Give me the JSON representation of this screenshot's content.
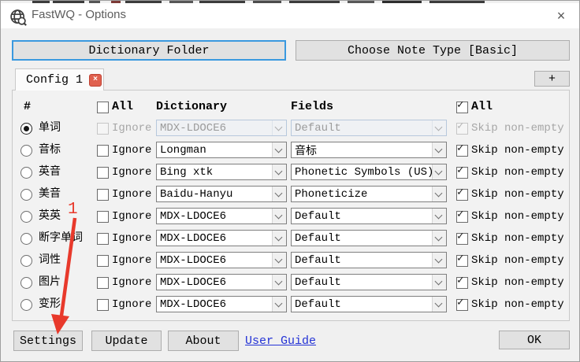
{
  "window": {
    "title": "FastWQ - Options"
  },
  "icons": {
    "app_icon": "globe-search",
    "close_icon": "×",
    "tab_close_icon": "×",
    "combo_chevron_icon": "v",
    "annotation_arrow_icon": "red-arrow-down"
  },
  "top_buttons": {
    "dictionary_folder": "Dictionary Folder",
    "choose_note_type": "Choose Note Type [Basic]"
  },
  "tabs": {
    "active_tab": "Config 1",
    "add_tab": "+"
  },
  "table": {
    "headers": {
      "hash": "#",
      "all_left": "All",
      "dictionary": "Dictionary",
      "fields": "Fields",
      "all_right": "All"
    },
    "all_left_checked": false,
    "all_right_checked": true,
    "ignore_label": "Ignore",
    "skip_label": "Skip non-empty",
    "rows": [
      {
        "label": "单词",
        "dictionary": "MDX-LDOCE6",
        "field": "Default",
        "selected": true,
        "disabled": true,
        "ignore_checked": false,
        "skip_checked": true
      },
      {
        "label": "音标",
        "dictionary": "Longman",
        "field": "音标",
        "selected": false,
        "disabled": false,
        "ignore_checked": false,
        "skip_checked": true
      },
      {
        "label": "英音",
        "dictionary": "Bing xtk",
        "field": "Phonetic Symbols (US)",
        "selected": false,
        "disabled": false,
        "ignore_checked": false,
        "skip_checked": true
      },
      {
        "label": "美音",
        "dictionary": "Baidu-Hanyu",
        "field": "Phoneticize",
        "selected": false,
        "disabled": false,
        "ignore_checked": false,
        "skip_checked": true
      },
      {
        "label": "英英",
        "dictionary": "MDX-LDOCE6",
        "field": "Default",
        "selected": false,
        "disabled": false,
        "ignore_checked": false,
        "skip_checked": true
      },
      {
        "label": "断字单词",
        "dictionary": "MDX-LDOCE6",
        "field": "Default",
        "selected": false,
        "disabled": false,
        "ignore_checked": false,
        "skip_checked": true
      },
      {
        "label": "词性",
        "dictionary": "MDX-LDOCE6",
        "field": "Default",
        "selected": false,
        "disabled": false,
        "ignore_checked": false,
        "skip_checked": true
      },
      {
        "label": "图片",
        "dictionary": "MDX-LDOCE6",
        "field": "Default",
        "selected": false,
        "disabled": false,
        "ignore_checked": false,
        "skip_checked": true
      },
      {
        "label": "变形",
        "dictionary": "MDX-LDOCE6",
        "field": "Default",
        "selected": false,
        "disabled": false,
        "ignore_checked": false,
        "skip_checked": true
      }
    ]
  },
  "footer": {
    "settings": "Settings",
    "update": "Update",
    "about": "About",
    "user_guide": "User Guide",
    "ok": "OK"
  },
  "annotation": {
    "step_label": "1"
  },
  "colors": {
    "dialog_bg": "#f0f0f0",
    "focus_border_blue": "#3a99df",
    "annotation_red": "#e8392b",
    "link_blue": "#2433d6",
    "tab_close_red": "#e0614f"
  }
}
